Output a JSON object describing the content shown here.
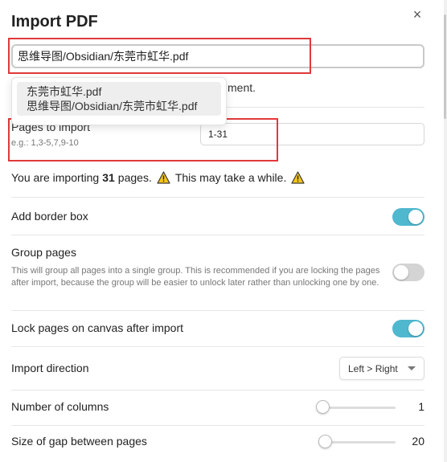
{
  "dialog": {
    "title": "Import PDF",
    "close_glyph": "×"
  },
  "file_input": {
    "value": "思维导图/Obsidian/东莞市虹华.pdf"
  },
  "suggestions": {
    "items": [
      {
        "line1": "东莞市虹华.pdf",
        "line2": "思维导图/Obsidian/东莞市虹华.pdf"
      }
    ],
    "behind_text": "ment."
  },
  "pages": {
    "label": "Pages to import",
    "hint": "e.g.: 1,3-5,7,9-10",
    "value": "1-31"
  },
  "importing": {
    "prefix": "You are importing",
    "count": "31",
    "suffix": "pages.",
    "warning_text": "This may take a while.",
    "warning_icon": "warning-triangle-icon",
    "warning_color": "#f5c518"
  },
  "options": {
    "border_box": {
      "label": "Add border box",
      "enabled": true
    },
    "group_pages": {
      "label": "Group pages",
      "description": "This will group all pages into a single group. This is recommended if you are locking the pages after import, because the group will be easier to unlock later rather than unlocking one by one.",
      "enabled": false
    },
    "lock_pages": {
      "label": "Lock pages on canvas after import",
      "enabled": true
    },
    "direction": {
      "label": "Import direction",
      "selected": "Left > Right"
    },
    "columns": {
      "label": "Number of columns",
      "value": "1"
    },
    "gap": {
      "label": "Size of gap between pages",
      "value": "20"
    }
  },
  "colors": {
    "accent": "#4fb8cf",
    "highlight_box": "#e0393b"
  }
}
